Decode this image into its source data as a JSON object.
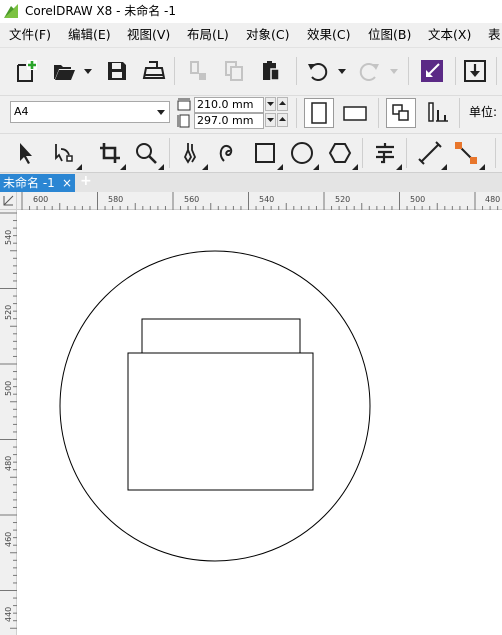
{
  "window": {
    "title": "CorelDRAW X8 - 未命名 -1"
  },
  "menu": {
    "file": "文件(F)",
    "edit": "编辑(E)",
    "view": "视图(V)",
    "layout": "布局(L)",
    "object": "对象(C)",
    "effects": "效果(C)",
    "bitmaps": "位图(B)",
    "text": "文本(X)",
    "table": "表"
  },
  "property_bar": {
    "paper_size": "A4",
    "width": "210.0 mm",
    "height": "297.0 mm",
    "units_label": "单位:"
  },
  "document_tabs": [
    {
      "label": "未命名 -1",
      "close": "×"
    }
  ],
  "add_tab": "+",
  "ruler": {
    "horizontal": [
      "600",
      "580",
      "560",
      "540",
      "520",
      "500",
      "480"
    ],
    "vertical": [
      "540",
      "520",
      "500",
      "480",
      "460",
      "440"
    ]
  },
  "colors": {
    "accent": "#2b86d3",
    "logo_green": "#7cc242",
    "purple": "#5b2a86"
  }
}
